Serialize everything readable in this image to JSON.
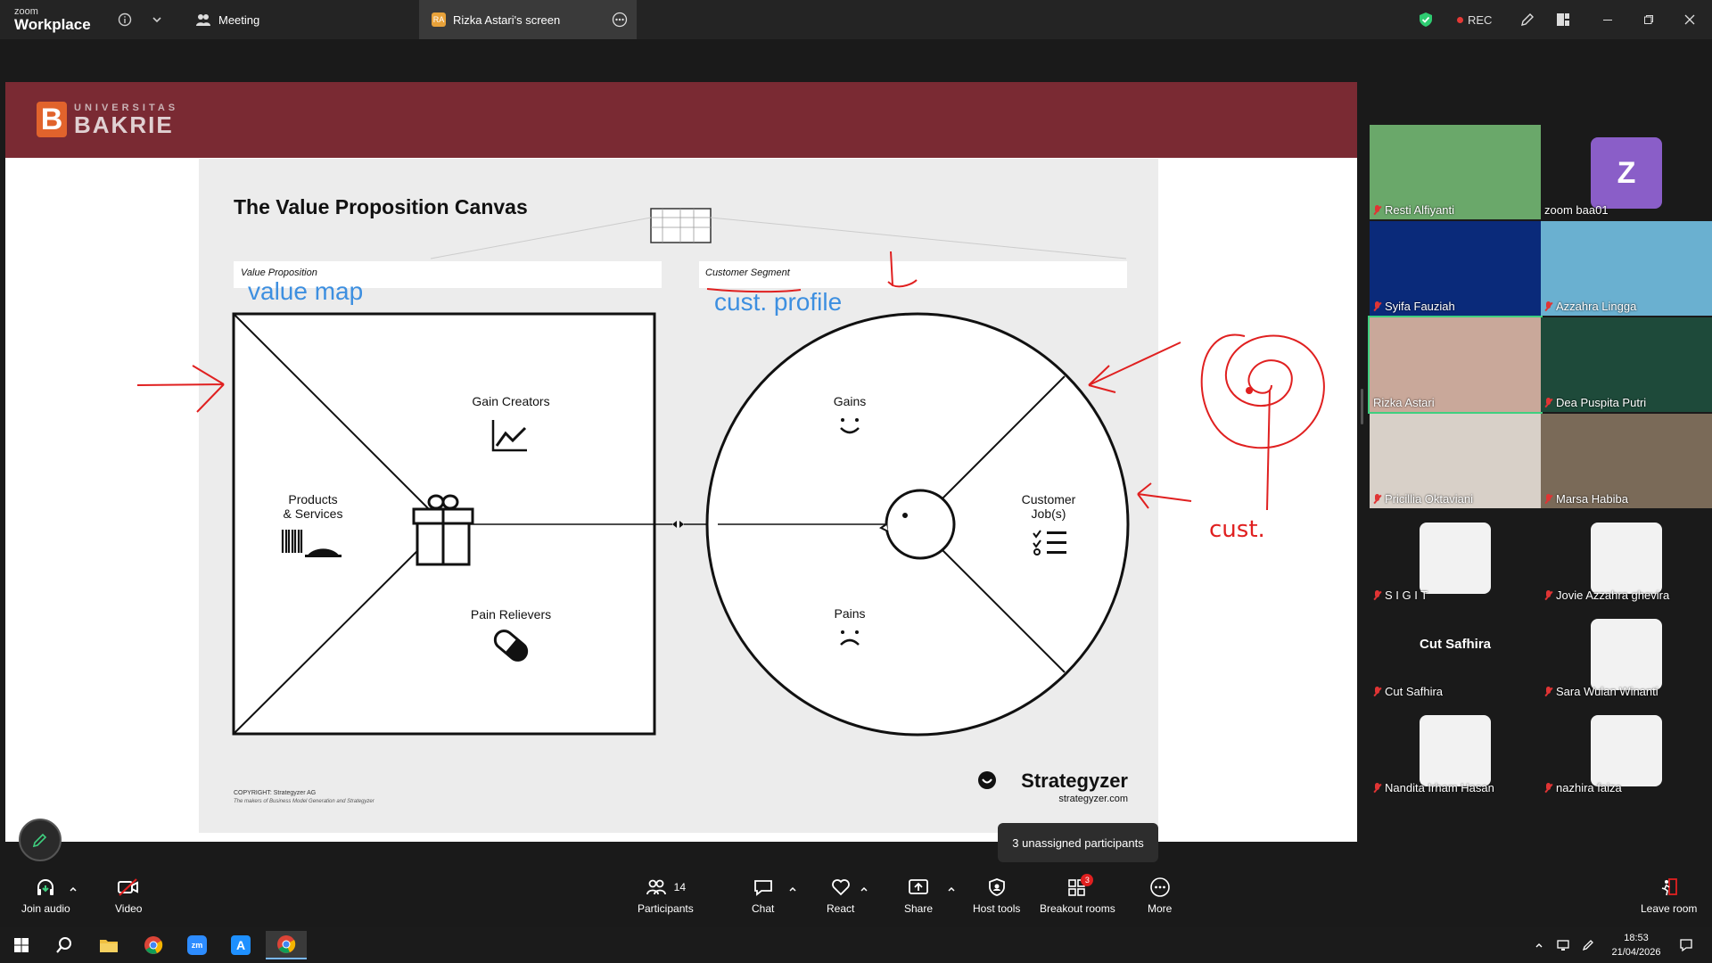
{
  "titlebar": {
    "logo_small": "zoom",
    "logo_big": "Workplace",
    "meeting_tab": "Meeting",
    "share_tab": "Rizka Astari's screen",
    "share_tab_initials": "RA",
    "rec_label": "REC"
  },
  "banner": {
    "brand_top": "UNIVERSITAS",
    "brand_bottom": "BAKRIE"
  },
  "slide": {
    "title": "The Value Proposition Canvas",
    "vp_label": "Value Proposition",
    "cs_label": "Customer Segment",
    "annotation_value_map": "value map",
    "annotation_cust_profile": "cust. profile",
    "annotation_cust": "cust.",
    "gain_creators": "Gain Creators",
    "products_line1": "Products",
    "products_line2": "& Services",
    "pain_relievers": "Pain Relievers",
    "gains": "Gains",
    "pains": "Pains",
    "customer_jobs_line1": "Customer",
    "customer_jobs_line2": "Job(s)",
    "copyright_line1": "COPYRIGHT: Strategyzer AG",
    "copyright_line2": "The makers of Business Model Generation and Strategyzer",
    "strategyzer": "Strategyzer",
    "strategyzer_url": "strategyzer.com"
  },
  "participants": [
    {
      "name": "Resti Alfiyanti",
      "muted": true,
      "bg": "#6aa86a"
    },
    {
      "name": "zoom baa01",
      "muted": false,
      "avatar": "Z",
      "bg": "#1a1a1a"
    },
    {
      "name": "Syifa Fauziah",
      "muted": true,
      "bg": "#0a2a7a"
    },
    {
      "name": "Azzahra Lingga",
      "muted": true,
      "bg": "#6ab0d0"
    },
    {
      "name": "Rizka Astari",
      "muted": false,
      "bg": "#c9a89a",
      "active": true
    },
    {
      "name": "Dea Puspita Putri",
      "muted": true,
      "bg": "#1e4a3a"
    },
    {
      "name": "Pricillia Oktaviani",
      "muted": true,
      "bg": "#d8d0c8"
    },
    {
      "name": "Marsa Habiba",
      "muted": true,
      "bg": "#7a6a58"
    },
    {
      "name": "S I G I T",
      "muted": true,
      "bg": "#1a1a1a",
      "avatar_img": true
    },
    {
      "name": "Jovie Azzahra ghevira",
      "muted": true,
      "bg": "#1a1a1a",
      "avatar_img": true
    },
    {
      "name": "Cut Safhira",
      "muted": true,
      "bg": "#1a1a1a",
      "center_text": "Cut Safhira"
    },
    {
      "name": "Sara Wulan Winanti",
      "muted": true,
      "bg": "#1a1a1a",
      "avatar_img": true
    },
    {
      "name": "Nandita Irham Hasan",
      "muted": true,
      "bg": "#1a1a1a",
      "avatar_img": true
    },
    {
      "name": "nazhira faiza",
      "muted": true,
      "bg": "#1a1a1a",
      "avatar_img": true
    }
  ],
  "toolbar": {
    "join_audio": "Join audio",
    "video": "Video",
    "participants": "Participants",
    "participants_count": "14",
    "chat": "Chat",
    "react": "React",
    "share": "Share",
    "host_tools": "Host tools",
    "breakout_rooms": "Breakout rooms",
    "breakout_badge": "3",
    "more": "More",
    "leave_room": "Leave room"
  },
  "popup": {
    "unassigned": "3 unassigned participants"
  },
  "taskbar": {
    "time": "18:53",
    "date": "21/04/2026"
  }
}
